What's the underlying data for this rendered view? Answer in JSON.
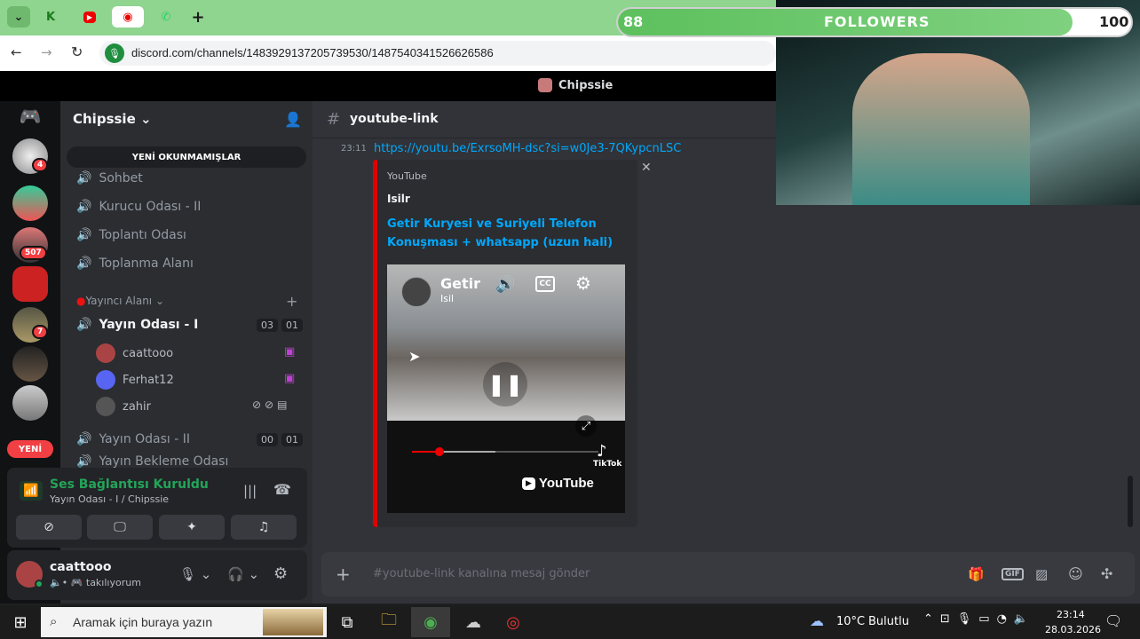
{
  "overlay": {
    "followers_current": "88",
    "followers_label": "FOLLOWERS",
    "followers_goal": "100",
    "followers_progress": 0.88
  },
  "browser": {
    "url": "discord.com/channels/1483929137205739530/1487540341526626586"
  },
  "window": {
    "title": "Chipssie"
  },
  "server": {
    "name": "Chipssie",
    "unread_banner": "YENİ OKUNMAMIŞLAR",
    "badges": [
      "4",
      "507",
      "7"
    ],
    "new_label": "YENİ"
  },
  "channels": {
    "top": [
      "Sohbet",
      "Kurucu Odası - II",
      "Toplantı Odası",
      "Toplanma Alanı"
    ],
    "category": "Yayıncı Alanı",
    "voice1": {
      "name": "Yayın Odası - I",
      "count": "03",
      "limit": "01"
    },
    "users": [
      "caattooo",
      "Ferhat12",
      "zahir"
    ],
    "voice2": {
      "name": "Yayın Odası - II",
      "count": "00",
      "limit": "01"
    },
    "partial": "Yayın Bekleme Odası"
  },
  "voice": {
    "status": "Ses Bağlantısı Kuruldu",
    "location": "Yayın Odası - I / Chipssie"
  },
  "user": {
    "name": "caattooo",
    "status": "takılıyorum"
  },
  "chat": {
    "channel": "youtube-link",
    "time": "23:11",
    "link": "https://youtu.be/ExrsoMH-dsc?si=w0Je3-7QKypcnLSC",
    "embed": {
      "provider": "YouTube",
      "author": "Isilr",
      "title": "Getir Kuryesi ve Suriyeli Telefon Konuşması + whatsapp (uzun hali)",
      "video_title": "Getir",
      "video_channel": "Isil",
      "tiktok": "TikTok",
      "youtube": "YouTube"
    },
    "placeholder": "#youtube-link kanalına mesaj gönder"
  },
  "taskbar": {
    "search_placeholder": "Aramak için buraya yazın",
    "weather_temp": "10°C",
    "weather_text": "Bulutlu",
    "time": "23:14",
    "date": "28.03.2026"
  }
}
